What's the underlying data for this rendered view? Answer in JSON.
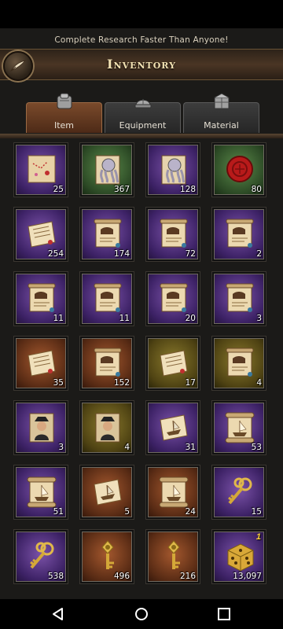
{
  "banner": "Complete Research Faster Than Anyone!",
  "title": "Inventory",
  "tabs": [
    {
      "label": "Item",
      "active": true,
      "icon": "scroll-bag-icon"
    },
    {
      "label": "Equipment",
      "active": false,
      "icon": "helmet-icon"
    },
    {
      "label": "Material",
      "active": false,
      "icon": "crate-icon"
    }
  ],
  "items": [
    {
      "name": "treasure-map",
      "bg": "purple",
      "qty": "25"
    },
    {
      "name": "octopus-scroll",
      "bg": "green",
      "qty": "367"
    },
    {
      "name": "octopus-scroll",
      "bg": "purple",
      "qty": "128"
    },
    {
      "name": "wax-seal",
      "bg": "green",
      "qty": "80"
    },
    {
      "name": "note-paper",
      "bg": "purple",
      "qty": "254"
    },
    {
      "name": "recipe-scroll",
      "bg": "purple",
      "qty": "174"
    },
    {
      "name": "recipe-scroll",
      "bg": "purple",
      "qty": "72"
    },
    {
      "name": "recipe-scroll",
      "bg": "purple",
      "qty": "2"
    },
    {
      "name": "recipe-scroll",
      "bg": "purple",
      "qty": "11"
    },
    {
      "name": "recipe-scroll",
      "bg": "purple",
      "qty": "11"
    },
    {
      "name": "recipe-scroll",
      "bg": "purple",
      "qty": "20"
    },
    {
      "name": "recipe-scroll",
      "bg": "purple",
      "qty": "3"
    },
    {
      "name": "note-paper",
      "bg": "brown",
      "qty": "35"
    },
    {
      "name": "recipe-scroll",
      "bg": "brown",
      "qty": "152"
    },
    {
      "name": "note-paper",
      "bg": "olive",
      "qty": "17"
    },
    {
      "name": "recipe-scroll",
      "bg": "olive",
      "qty": "4"
    },
    {
      "name": "captain-portrait",
      "bg": "purple",
      "qty": "3"
    },
    {
      "name": "captain-portrait",
      "bg": "olive",
      "qty": "4"
    },
    {
      "name": "ship-paper",
      "bg": "purple",
      "qty": "31"
    },
    {
      "name": "ship-scroll",
      "bg": "purple",
      "qty": "53"
    },
    {
      "name": "ship-scroll",
      "bg": "purple",
      "qty": "51"
    },
    {
      "name": "ship-paper",
      "bg": "brown",
      "qty": "5"
    },
    {
      "name": "ship-scroll",
      "bg": "brown",
      "qty": "24"
    },
    {
      "name": "golden-key",
      "bg": "purple",
      "qty": "15"
    },
    {
      "name": "golden-key",
      "bg": "purple",
      "qty": "538"
    },
    {
      "name": "ornate-key",
      "bg": "brown",
      "qty": "496"
    },
    {
      "name": "ornate-key",
      "bg": "brown",
      "qty": "216"
    },
    {
      "name": "golden-dice",
      "bg": "purple",
      "qty": "13,097",
      "badge": "1"
    }
  ],
  "colors": {
    "bg_purple": "#5a3a8a",
    "bg_green": "#3f6a34",
    "bg_brown": "#7a3d1e",
    "bg_olive": "#6a5a1e",
    "accent_gold": "#f3e2b3"
  }
}
